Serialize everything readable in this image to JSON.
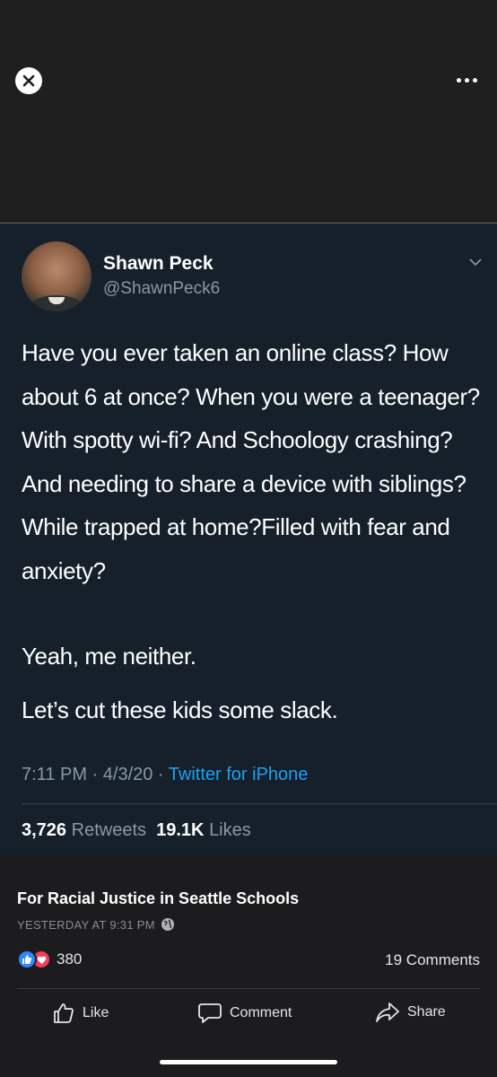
{
  "tweet": {
    "author_name": "Shawn Peck",
    "author_handle": "@ShawnPeck6",
    "body": "Have you ever taken an online class? How about 6 at once? When you were a teenager? With spotty wi-fi? And Schoology crashing? And needing to share a device with siblings? While trapped at home?Filled with fear and anxiety?",
    "line2": "Yeah, me neither.",
    "line3": "Let’s cut these kids some slack.",
    "time": "7:11 PM · 4/3/20 · ",
    "source": "Twitter for iPhone",
    "retweets_count": "3,726",
    "retweets_label": "Retweets",
    "likes_count": "19.1K",
    "likes_label": "Likes"
  },
  "post": {
    "group_name": "For Racial Justice in Seattle Schools",
    "timestamp": "YESTERDAY AT 9:31 PM",
    "reaction_count": "380",
    "comments_count": "19 Comments"
  },
  "actions": {
    "like": "Like",
    "comment": "Comment",
    "share": "Share"
  },
  "icons": [
    "close-icon",
    "more-icon",
    "chevron-down-icon",
    "globe-icon",
    "thumbs-up-icon",
    "heart-icon",
    "comment-icon",
    "share-icon"
  ],
  "colors": {
    "tweet_bg": "#15202b",
    "link_blue": "#1da1f2",
    "like_blue": "#2d88ff",
    "love_red": "#f33e58"
  }
}
